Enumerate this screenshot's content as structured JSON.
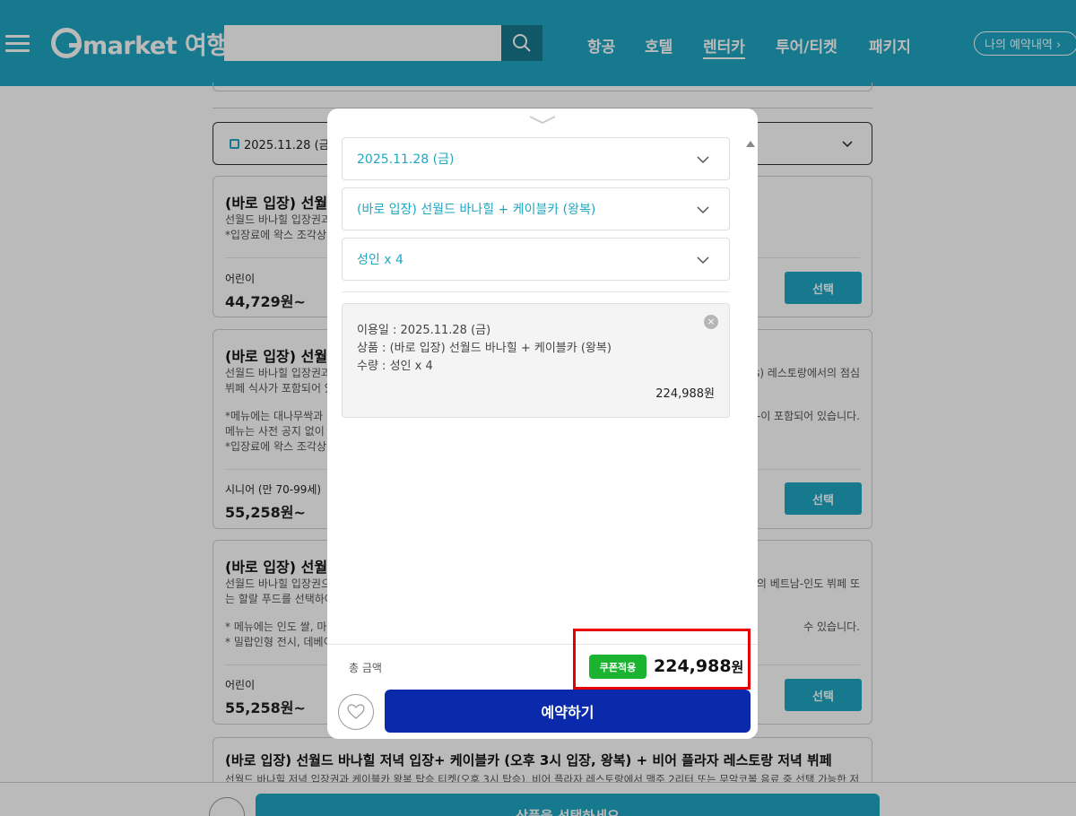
{
  "header": {
    "logo": "market 여행",
    "search_placeholder": "",
    "nav": [
      "항공",
      "호텔",
      "렌터카",
      "투어/티켓",
      "패키지"
    ],
    "nav_active": "렌터카",
    "my_reservations": "나의 예약내역 ›"
  },
  "background": {
    "date_field": "2025.11.28 (금)",
    "cards": [
      {
        "title": "(바로 입장) 선월드",
        "desc_left": [
          "선월드 바나힐 입장권과",
          "*입장료에 왁스 조각상 "
        ],
        "desc_right": [],
        "age": "어린이",
        "price": "44,729원~",
        "select_label": "선택"
      },
      {
        "title": "(바로 입장) 선월드",
        "desc_left": [
          "선월드 바나힐 입장권과",
          "뷔페 식사가 포함되어 있",
          "",
          "*메뉴에는 대나무싹과 ",
          "메뉴는 사전 공지 없이 변",
          "*입장료에 왁스 조각상 "
        ],
        "desc_right": [
          "s) 레스토랑에서의 점심",
          "",
          "",
          "-이 포함되어 있습니다."
        ],
        "age": "시니어 (만 70-99세)",
        "price": "55,258원~",
        "select_label": "선택"
      },
      {
        "title": "(바로 입장) 선월드",
        "desc_left": [
          "선월드 바나힐 입장권으",
          "는 할랄 푸드를 선택하여",
          "",
          "* 메뉴에는 인도 쌀, 마드",
          "* 밀랍인형 전시, 데베이"
        ],
        "desc_right": [
          "의 베트남-인도 뷔페 또",
          "",
          "",
          "수 있습니다."
        ],
        "age": "어린이",
        "price": "55,258원~",
        "select_label": "선택"
      },
      {
        "title": "(바로 입장) 선월드 바나힐 저녁 입장+ 케이블카 (오후 3시 입장, 왕복) + 비어 플라자 레스토랑 저녁 뷔페",
        "desc_left": [
          "선월드 바나힐 저녁 입장권과 케이블카 왕복 탑승 티켓(오후 3시 탑승), 비어 플라자 레스토랑에서 맥주 2리터 또는 무악코볼 음료 중 선택 가능한 저"
        ],
        "desc_right": [],
        "age": "",
        "price": "",
        "select_label": ""
      }
    ],
    "bottom_cta": "상품을 선택하세요"
  },
  "modal": {
    "selects": [
      {
        "label": "2025.11.28 (금)"
      },
      {
        "label": "(바로 입장) 선월드 바나힐 + 케이블카 (왕복)"
      },
      {
        "label": "성인 x 4"
      }
    ],
    "summary": {
      "use_date": "이용일 : 2025.11.28 (금)",
      "product": "상품 : (바로 입장) 선월드 바나힐 + 케이블카 (왕복)",
      "quantity": "수량 : 성인 x 4",
      "price": "224,988원",
      "close_icon": "×"
    },
    "total_label": "총 금액",
    "coupon_badge": "쿠폰적용",
    "total_amount": "224,988",
    "total_unit": "원",
    "reserve_button": "예약하기"
  },
  "colors": {
    "brand": "#1fa7c2",
    "reserve": "#0a2aab",
    "coupon": "#1bb32f",
    "highlight": "#e60000"
  }
}
